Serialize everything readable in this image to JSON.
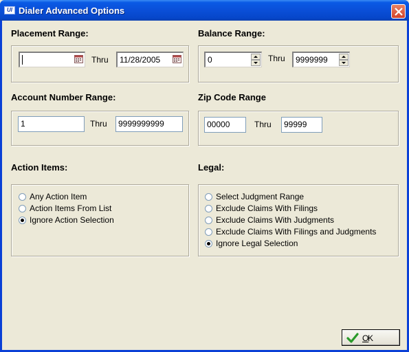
{
  "window": {
    "title": "Dialer Advanced Options",
    "app_icon_text": "UI"
  },
  "placement": {
    "label": "Placement Range:",
    "from_value": "",
    "thru_label": "Thru",
    "to_value": "11/28/2005"
  },
  "balance": {
    "label": "Balance Range:",
    "from_value": "0",
    "thru_label": "Thru",
    "to_value": "9999999"
  },
  "account": {
    "label": "Account Number Range:",
    "from_value": "1",
    "thru_label": "Thru",
    "to_value": "9999999999"
  },
  "zip": {
    "label": "Zip Code Range",
    "from_value": "00000",
    "thru_label": "Thru",
    "to_value": "99999"
  },
  "action_items": {
    "label": "Action Items:",
    "options": [
      {
        "label": "Any Action Item",
        "checked": false
      },
      {
        "label": "Action Items From List",
        "checked": false
      },
      {
        "label": "Ignore Action Selection",
        "checked": true
      }
    ]
  },
  "legal": {
    "label": "Legal:",
    "options": [
      {
        "label": "Select Judgment Range",
        "checked": false
      },
      {
        "label": "Exclude Claims With Filings",
        "checked": false
      },
      {
        "label": "Exclude Claims With Judgments",
        "checked": false
      },
      {
        "label": "Exclude Claims With Filings and Judgments",
        "checked": false
      },
      {
        "label": "Ignore Legal Selection",
        "checked": true
      }
    ]
  },
  "ok_button": {
    "mnemonic": "O",
    "rest": "K"
  },
  "colors": {
    "titlebar": "#0a4fd8",
    "dialog_bg": "#ece9d8",
    "close_button": "#d3432b",
    "ok_check": "#2a9a2a"
  }
}
